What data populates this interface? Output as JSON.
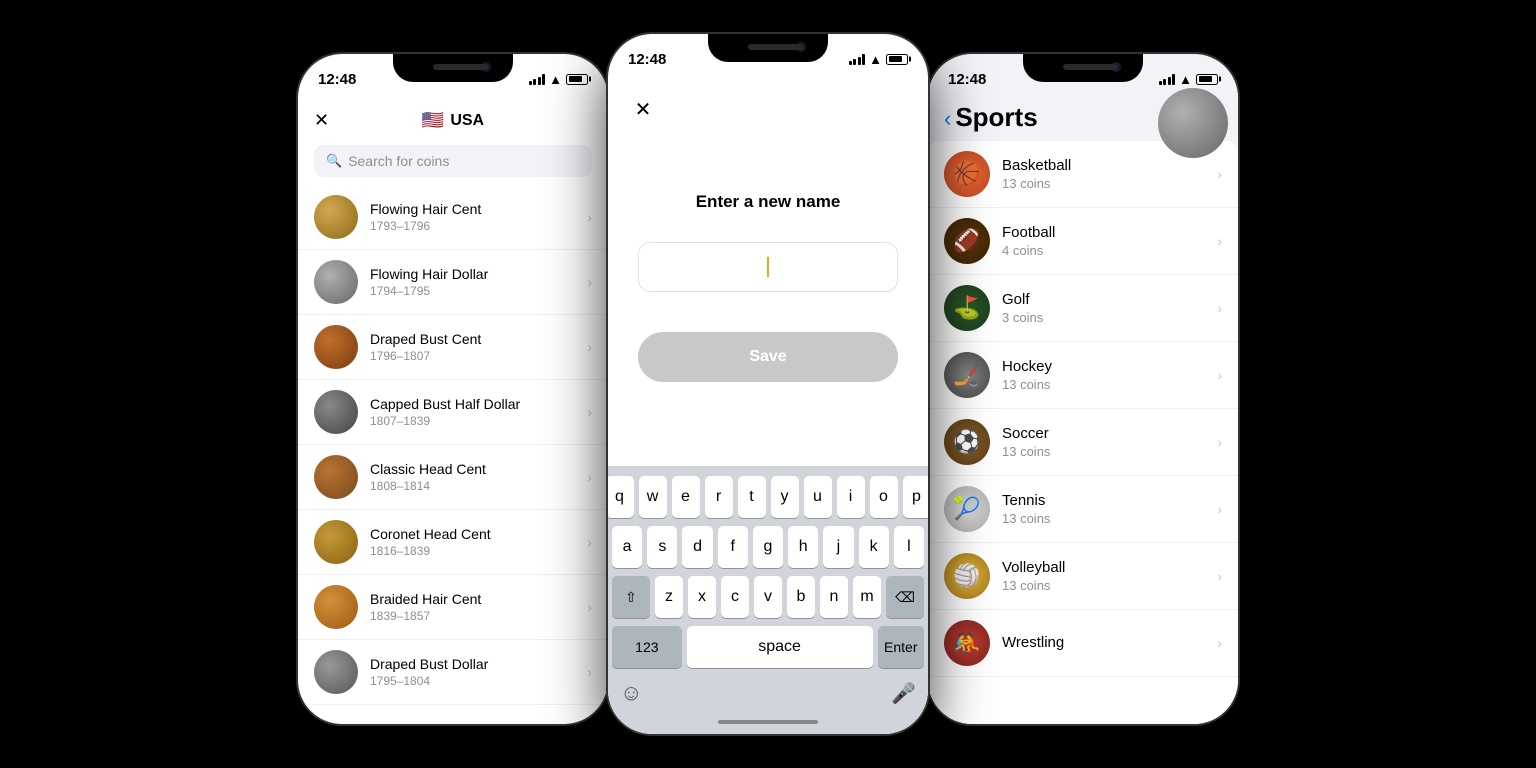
{
  "phones": {
    "left": {
      "time": "12:48",
      "title": "USA",
      "flag": "🇺🇸",
      "search_placeholder": "Search for coins",
      "coins": [
        {
          "name": "Flowing Hair Cent",
          "date": "1793–1796",
          "color_class": "coin-flowing-hair-cent"
        },
        {
          "name": "Flowing Hair Dollar",
          "date": "1794–1795",
          "color_class": "coin-flowing-hair-dollar"
        },
        {
          "name": "Draped Bust Cent",
          "date": "1796–1807",
          "color_class": "coin-draped-bust-cent"
        },
        {
          "name": "Capped Bust Half Dollar",
          "date": "1807–1839",
          "color_class": "coin-capped-bust"
        },
        {
          "name": "Classic Head Cent",
          "date": "1808–1814",
          "color_class": "coin-classic-head"
        },
        {
          "name": "Coronet Head Cent",
          "date": "1816–1839",
          "color_class": "coin-coronet"
        },
        {
          "name": "Braided Hair Cent",
          "date": "1839–1857",
          "color_class": "coin-braided"
        },
        {
          "name": "Draped Bust Dollar",
          "date": "1795–1804",
          "color_class": "coin-draped-bust-dollar"
        }
      ]
    },
    "center": {
      "time": "12:48",
      "dialog_title": "Enter a new name",
      "input_placeholder": "",
      "save_label": "Save",
      "keyboard": {
        "row1": [
          "q",
          "w",
          "e",
          "r",
          "t",
          "y",
          "u",
          "i",
          "o",
          "p"
        ],
        "row2": [
          "a",
          "s",
          "d",
          "f",
          "g",
          "h",
          "j",
          "k",
          "l"
        ],
        "row3": [
          "z",
          "x",
          "c",
          "v",
          "b",
          "n",
          "m"
        ],
        "bottom_left": "123",
        "space": "space",
        "enter": "Enter"
      }
    },
    "right": {
      "time": "12:48",
      "title": "Sports",
      "back_label": "‹",
      "sports": [
        {
          "name": "Basketball",
          "coins": "13 coins",
          "color_class": "av-basketball",
          "emoji": "🏀"
        },
        {
          "name": "Football",
          "coins": "4 coins",
          "color_class": "av-football",
          "emoji": "🏈"
        },
        {
          "name": "Golf",
          "coins": "3 coins",
          "color_class": "av-golf",
          "emoji": "⛳"
        },
        {
          "name": "Hockey",
          "coins": "13 coins",
          "color_class": "av-hockey",
          "emoji": "🏒"
        },
        {
          "name": "Soccer",
          "coins": "13 coins",
          "color_class": "av-soccer",
          "emoji": "⚽"
        },
        {
          "name": "Tennis",
          "coins": "13 coins",
          "color_class": "av-tennis",
          "emoji": "🎾"
        },
        {
          "name": "Volleyball",
          "coins": "13 coins",
          "color_class": "av-volleyball",
          "emoji": "🏐"
        },
        {
          "name": "Wrestling",
          "coins": "",
          "color_class": "av-wrestling",
          "emoji": "🤼"
        }
      ]
    }
  }
}
